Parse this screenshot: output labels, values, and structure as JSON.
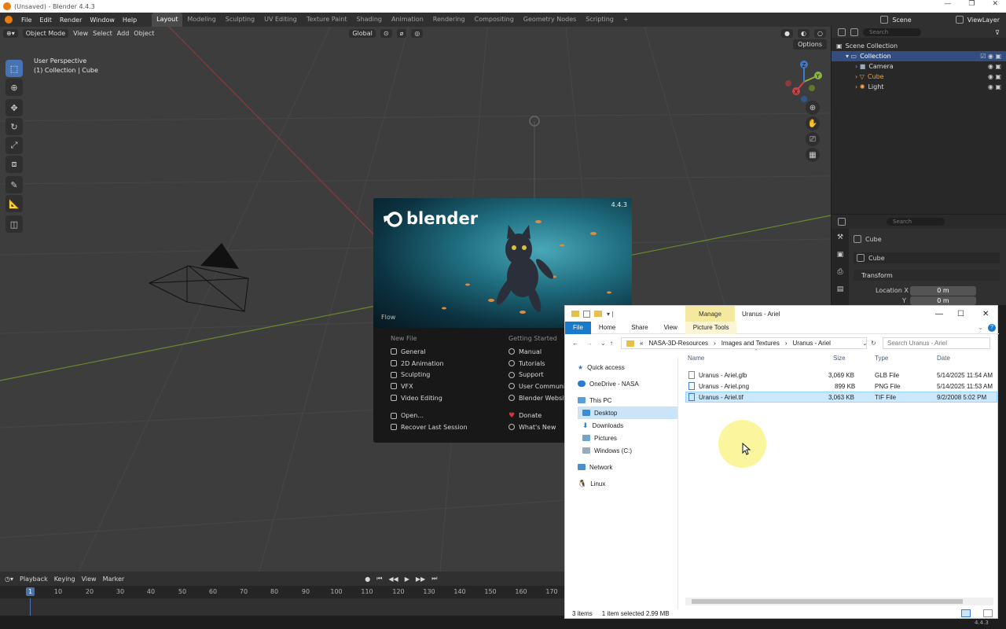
{
  "window": {
    "title": "(Unsaved) - Blender 4.4.3",
    "controls": [
      "—",
      "❐",
      "✕"
    ]
  },
  "menubar": {
    "items": [
      "File",
      "Edit",
      "Render",
      "Window",
      "Help"
    ],
    "workspaces": [
      "Layout",
      "Modeling",
      "Sculpting",
      "UV Editing",
      "Texture Paint",
      "Shading",
      "Animation",
      "Rendering",
      "Compositing",
      "Geometry Nodes",
      "Scripting"
    ],
    "active_workspace": "Layout",
    "add_tab": "+",
    "scene": "Scene",
    "view_layer": "ViewLayer"
  },
  "viewport": {
    "mode": "Object Mode",
    "menus": [
      "View",
      "Select",
      "Add",
      "Object"
    ],
    "transform": "Global",
    "info_line1": "User Perspective",
    "info_line2": "(1) Collection | Cube",
    "options": "Options",
    "gizmo": {
      "x": "X",
      "y": "Y",
      "z": "Z"
    }
  },
  "outliner": {
    "search_placeholder": "Search",
    "rows": [
      {
        "label": "Scene Collection",
        "color": "#d0d0d0"
      },
      {
        "label": "Collection",
        "color": "#ffffff"
      },
      {
        "label": "Camera",
        "color": "#d0d0d0"
      },
      {
        "label": "Cube",
        "color": "#f0a040"
      },
      {
        "label": "Light",
        "color": "#d0d0d0"
      }
    ]
  },
  "properties": {
    "search_placeholder": "Search",
    "object_name": "Cube",
    "data_name": "Cube",
    "section": "Transform",
    "location_x_label": "Location X",
    "location_x_value": "0 m",
    "location_y_label": "Y",
    "location_y_value": "0 m"
  },
  "timeline": {
    "menus": [
      "Playback",
      "Keying",
      "View",
      "Marker"
    ],
    "current_frame": "1",
    "ticks": [
      "10",
      "20",
      "30",
      "40",
      "50",
      "60",
      "70",
      "80",
      "90",
      "100",
      "110",
      "120",
      "130",
      "140",
      "150",
      "160",
      "170"
    ]
  },
  "splash": {
    "logo": "blender",
    "version": "4.4.3",
    "caption": "Flow",
    "new_file_title": "New File",
    "new_file_items": [
      "General",
      "2D Animation",
      "Sculpting",
      "VFX",
      "Video Editing"
    ],
    "open_items": [
      "Open...",
      "Recover Last Session"
    ],
    "getting_started_title": "Getting Started",
    "getting_started_items": [
      "Manual",
      "Tutorials",
      "Support",
      "User Communities",
      "Blender Website"
    ],
    "donate_items": [
      "Donate",
      "What's New"
    ],
    "donate_color": "#e0303a"
  },
  "explorer": {
    "title": "Uranus - Ariel",
    "manage": "Manage",
    "tabs": [
      "File",
      "Home",
      "Share",
      "View",
      "Picture Tools"
    ],
    "breadcrumb": [
      "«",
      "NASA-3D-Resources",
      "Images and Textures",
      "Uranus - Ariel"
    ],
    "search_placeholder": "Search Uranus - Ariel",
    "nav": [
      "Quick access",
      "OneDrive - NASA",
      "This PC",
      "Desktop",
      "Downloads",
      "Pictures",
      "Windows (C:)",
      "Network",
      "Linux"
    ],
    "columns": [
      "Name",
      "Size",
      "Type",
      "Date"
    ],
    "files": [
      {
        "name": "Uranus - Ariel.glb",
        "size": "3,069 KB",
        "type": "GLB File",
        "date": "5/14/2025 11:54 AM"
      },
      {
        "name": "Uranus - Ariel.png",
        "size": "899 KB",
        "type": "PNG File",
        "date": "5/14/2025 11:53 AM"
      },
      {
        "name": "Uranus - Ariel.tif",
        "size": "3,063 KB",
        "type": "TIF File",
        "date": "9/2/2008 5:02 PM"
      }
    ],
    "status_count": "3 items",
    "status_selected": "1 item selected  2.99 MB"
  },
  "statusbar": {
    "version": "4.4.3"
  }
}
